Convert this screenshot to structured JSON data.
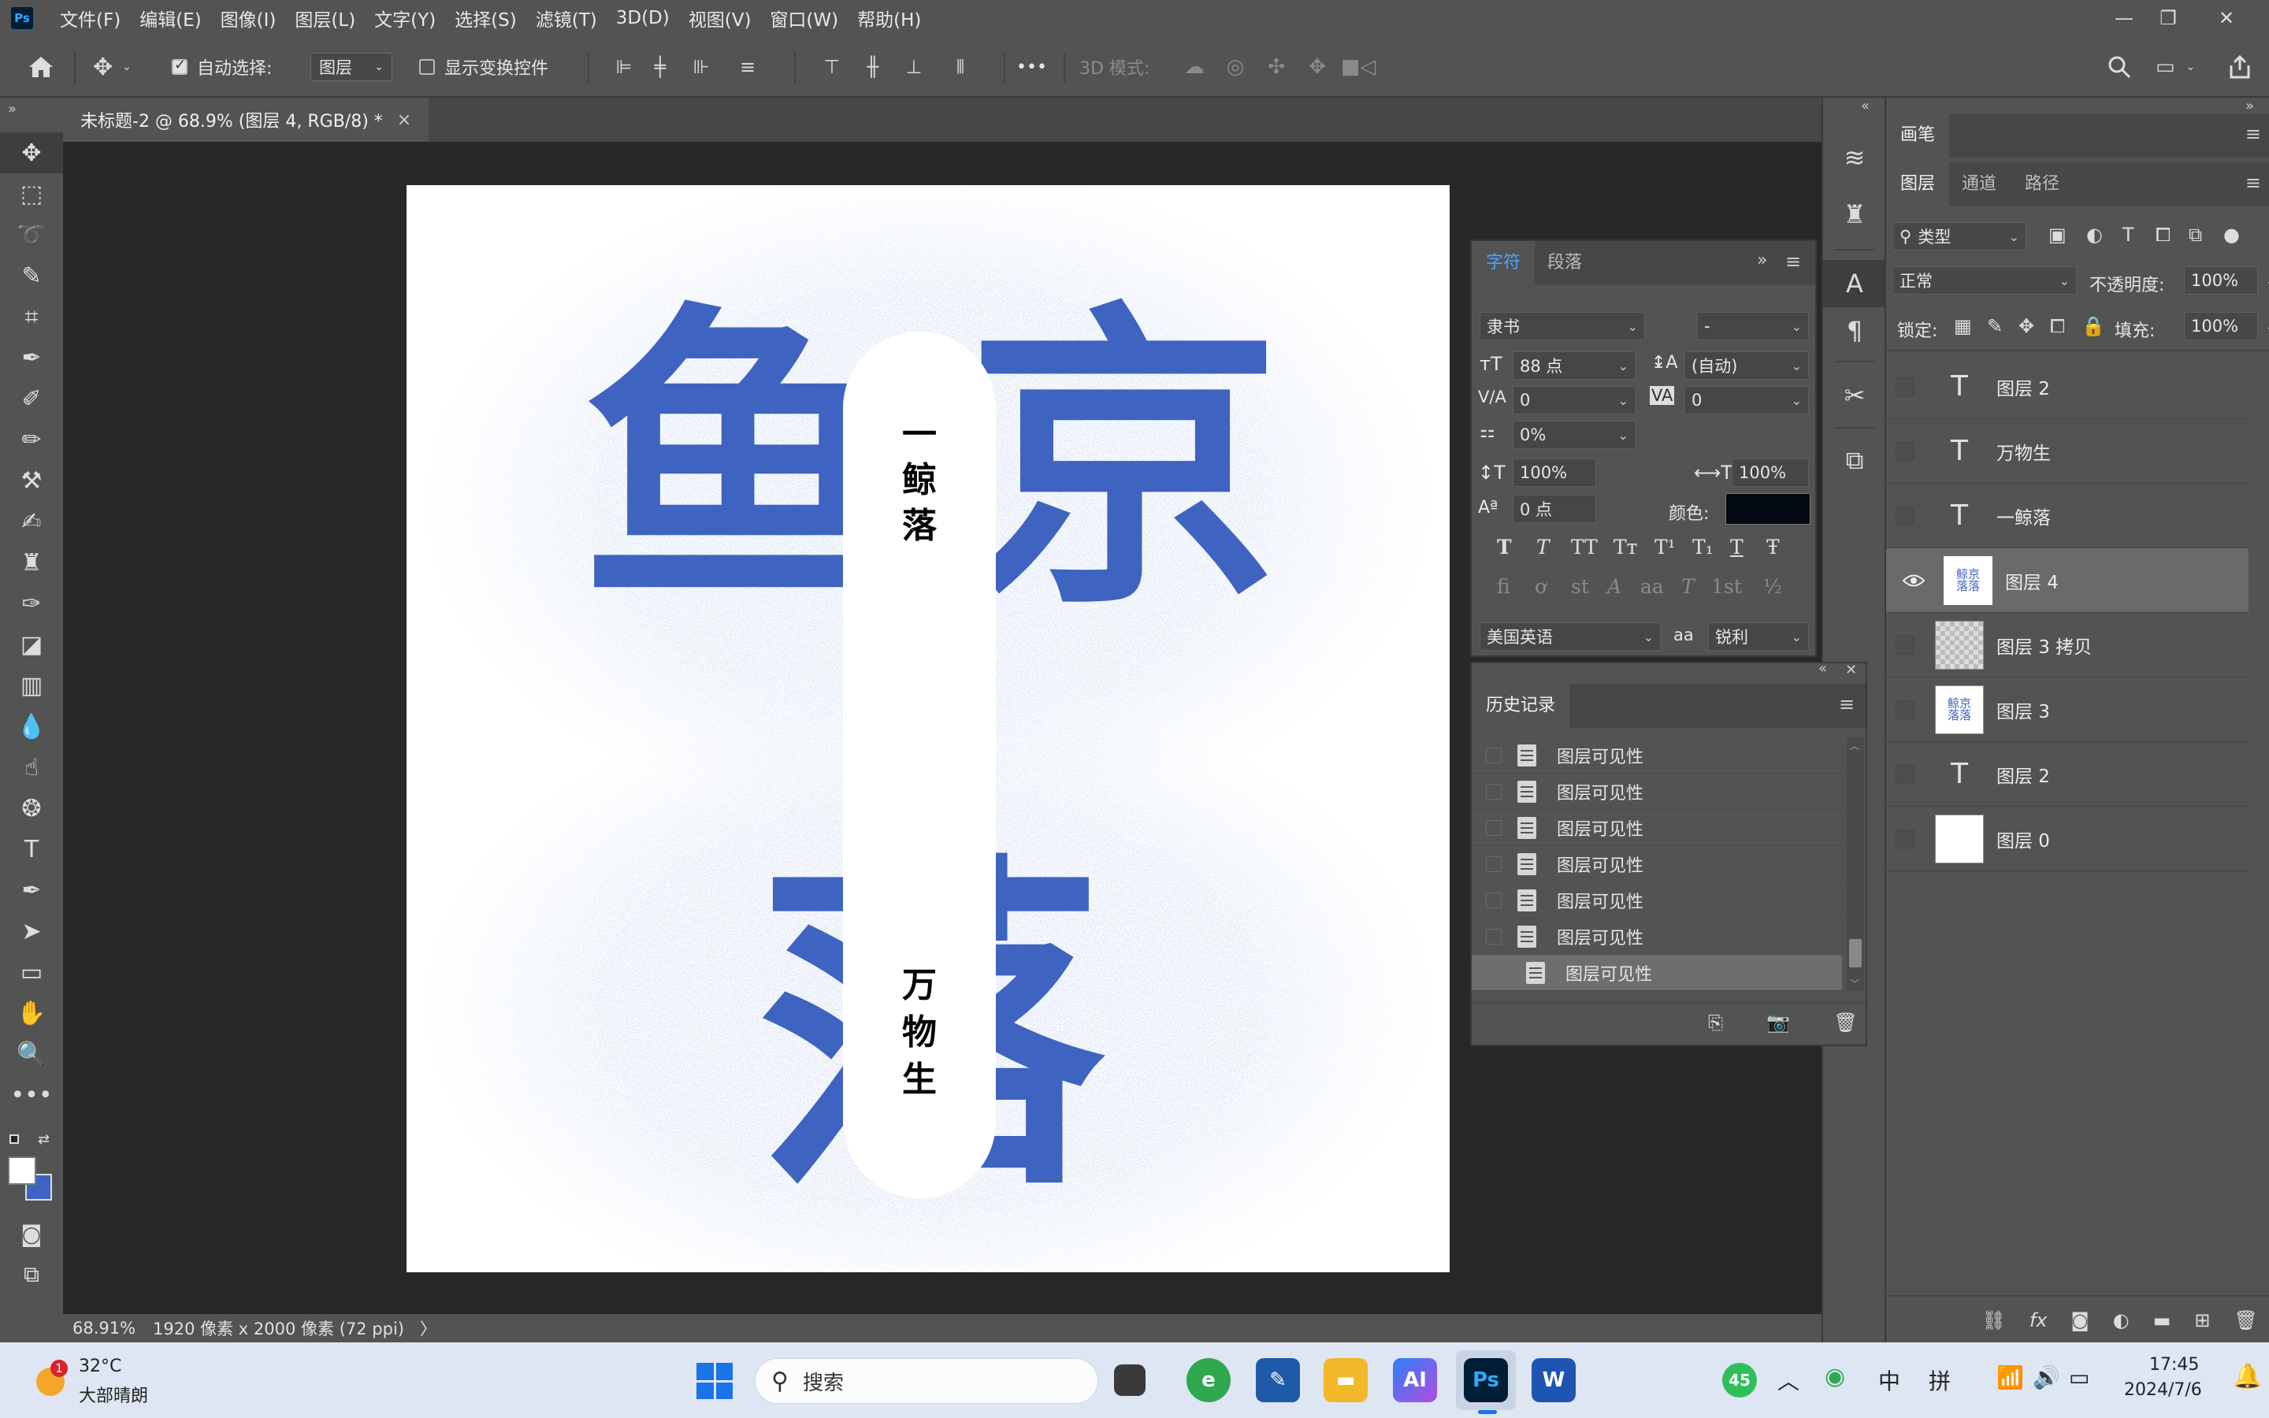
{
  "app": {
    "logo": "Ps"
  },
  "menu": [
    "文件(F)",
    "编辑(E)",
    "图像(I)",
    "图层(L)",
    "文字(Y)",
    "选择(S)",
    "滤镜(T)",
    "3D(D)",
    "视图(V)",
    "窗口(W)",
    "帮助(H)"
  ],
  "options": {
    "auto_select_label": "自动选择:",
    "auto_select_value": "图层",
    "show_transform_label": "显示变换控件",
    "mode3d_label": "3D 模式:",
    "more": "•••"
  },
  "document": {
    "tab_title": "未标题-2 @ 68.9% (图层 4, RGB/8) *",
    "close": "×",
    "zoom": "68.91%",
    "size_info": "1920 像素 x 2000 像素 (72 ppi)",
    "status_arrow": "〉"
  },
  "artwork": {
    "big_chars": [
      "鱼",
      "京",
      "落"
    ],
    "top_vertical_text": [
      "一",
      "鲸",
      "落"
    ],
    "bottom_vertical_text": [
      "万",
      "物",
      "生"
    ],
    "accent_color": "#3e63c0"
  },
  "character_panel": {
    "tabs": [
      "字符",
      "段落"
    ],
    "font_family": "隶书",
    "font_style": "-",
    "font_size": "88 点",
    "leading": "(自动)",
    "kerning": "0",
    "tracking": "0",
    "tsume": "0%",
    "vscale": "100%",
    "hscale": "100%",
    "baseline": "0 点",
    "color_label": "颜色:",
    "color_value": "#040a14",
    "style_glyphs": [
      "T",
      "T",
      "TT",
      "Tт",
      "T¹",
      "T₁",
      "T",
      "Ŧ"
    ],
    "opentype_glyphs": [
      "fi",
      "ơ",
      "st",
      "A",
      "aa",
      "T",
      "1st",
      "½"
    ],
    "language": "美国英语",
    "aa_label": "aa",
    "antialias": "锐利"
  },
  "history_panel": {
    "title": "历史记录",
    "items": [
      "图层可见性",
      "图层可见性",
      "图层可见性",
      "图层可见性",
      "图层可见性",
      "图层可见性",
      "图层可见性"
    ]
  },
  "brush_panel": {
    "title": "画笔"
  },
  "layers_panel": {
    "tabs": [
      "图层",
      "通道",
      "路径"
    ],
    "filter_label": "类型",
    "blend_mode": "正常",
    "opacity_label": "不透明度:",
    "opacity_value": "100%",
    "lock_label": "锁定:",
    "fill_label": "填充:",
    "fill_value": "100%",
    "layers": [
      {
        "name": "图层 2",
        "kind": "text",
        "visible": false
      },
      {
        "name": "万物生",
        "kind": "text",
        "visible": false
      },
      {
        "name": "一鲸落",
        "kind": "text",
        "visible": false
      },
      {
        "name": "图层 4",
        "kind": "image",
        "visible": true,
        "selected": true
      },
      {
        "name": "图层 3 拷贝",
        "kind": "checker",
        "visible": false
      },
      {
        "name": "图层 3",
        "kind": "image",
        "visible": false
      },
      {
        "name": "图层 2",
        "kind": "text",
        "visible": false
      },
      {
        "name": "图层 0",
        "kind": "white",
        "visible": false
      }
    ],
    "footer_icons": [
      "link-icon",
      "fx-icon",
      "mask-icon",
      "adjustment-icon",
      "group-icon",
      "new-layer-icon",
      "trash-icon"
    ]
  },
  "taskbar": {
    "weather_temp": "32°C",
    "weather_desc": "大部晴朗",
    "weather_badge": "1",
    "search_placeholder": "搜索",
    "tray_badge": "45",
    "ime_1": "中",
    "ime_2": "拼",
    "time": "17:45",
    "date": "2024/7/6"
  }
}
